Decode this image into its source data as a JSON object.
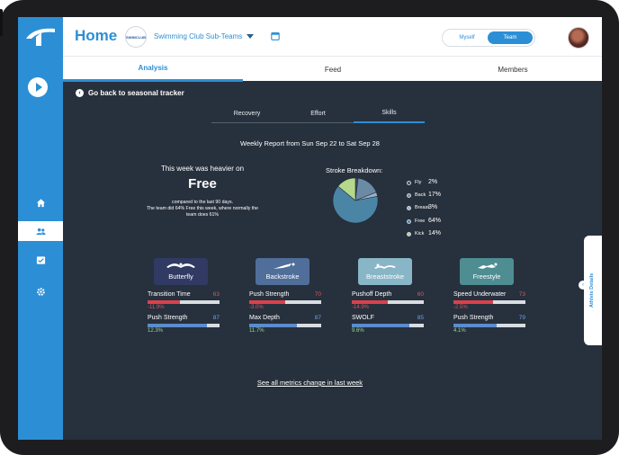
{
  "header": {
    "title": "Home",
    "club_name": "Swimming Club Sub-Teams",
    "club_logo_text": "SWIMCLUB",
    "toggle": {
      "options": [
        "Myself",
        "Team"
      ],
      "selected": "Team"
    }
  },
  "tabs": [
    {
      "label": "Analysis",
      "active": true
    },
    {
      "label": "Feed",
      "active": false
    },
    {
      "label": "Members",
      "active": false
    }
  ],
  "back_link": "Go back to seasonal tracker",
  "subtabs": [
    {
      "label": "Recovery",
      "active": false
    },
    {
      "label": "Effort",
      "active": false
    },
    {
      "label": "Skills",
      "active": true
    }
  ],
  "report_title": "Weekly Report from Sun Sep 22 to Sat Sep 28",
  "summary": {
    "lead": "This week was heavier on",
    "stroke": "Free",
    "compare_1": "compared to the last 90 days.",
    "compare_2": "The team did 64% Free this week, where normally the",
    "compare_3": "team does 61%"
  },
  "breakdown": {
    "title": "Stroke Breakdown:",
    "items": [
      {
        "name": "Fly",
        "value": "2%",
        "pct": 2,
        "color": "#3f4c63"
      },
      {
        "name": "Back",
        "value": "17%",
        "pct": 17,
        "color": "#6b8aa6"
      },
      {
        "name": "Breast",
        "value": "3%",
        "pct": 3,
        "color": "#9bb3c7"
      },
      {
        "name": "Free",
        "value": "64%",
        "pct": 64,
        "color": "#4b85a6"
      },
      {
        "name": "Kick",
        "value": "14%",
        "pct": 14,
        "color": "#b5d98a"
      }
    ]
  },
  "strokes": [
    {
      "label": "Butterfly",
      "color": "#303a63",
      "metrics": [
        {
          "name": "Transition Time",
          "score": "63",
          "change": "-11.9%",
          "trend": "neg",
          "fill": 0.45,
          "fill_color": "#d9414c",
          "score_color": "#e0525a"
        },
        {
          "name": "Push Strength",
          "score": "87",
          "change": "12.3%",
          "trend": "pos",
          "fill": 0.82,
          "fill_color": "#5b8ccc",
          "score_color": "#6aa2e6"
        }
      ]
    },
    {
      "label": "Backstroke",
      "color": "#4f6e9a",
      "metrics": [
        {
          "name": "Push Strength",
          "score": "70",
          "change": "-3.0%",
          "trend": "neg",
          "fill": 0.5,
          "fill_color": "#d9414c",
          "score_color": "#e0525a"
        },
        {
          "name": "Max Depth",
          "score": "87",
          "change": "11.7%",
          "trend": "pos",
          "fill": 0.66,
          "fill_color": "#5b8ccc",
          "score_color": "#6aa2e6"
        }
      ]
    },
    {
      "label": "Breaststroke",
      "color": "#88b6c6",
      "metrics": [
        {
          "name": "Pushoff Depth",
          "score": "60",
          "change": "-14.9%",
          "trend": "neg",
          "fill": 0.5,
          "fill_color": "#d9414c",
          "score_color": "#e0525a"
        },
        {
          "name": "SWOLF",
          "score": "85",
          "change": "9.6%",
          "trend": "pos",
          "fill": 0.8,
          "fill_color": "#5b8ccc",
          "score_color": "#6aa2e6"
        }
      ]
    },
    {
      "label": "Freestyle",
      "color": "#4e8d92",
      "metrics": [
        {
          "name": "Speed Underwater",
          "score": "73",
          "change": "-2.5%",
          "trend": "neg",
          "fill": 0.55,
          "fill_color": "#d9414c",
          "score_color": "#e0525a"
        },
        {
          "name": "Push Strength",
          "score": "79",
          "change": "4.1%",
          "trend": "pos",
          "fill": 0.6,
          "fill_color": "#5b8ccc",
          "score_color": "#6aa2e6"
        }
      ]
    }
  ],
  "see_all": "See all metrics change in last week",
  "athlete_details": "Athlete Details",
  "sidebar_icons": [
    "play-icon",
    "home-icon",
    "team-icon",
    "checklist-icon",
    "settings-icon"
  ],
  "colors": {
    "accent": "#2c8fd6",
    "background": "#27303d"
  }
}
